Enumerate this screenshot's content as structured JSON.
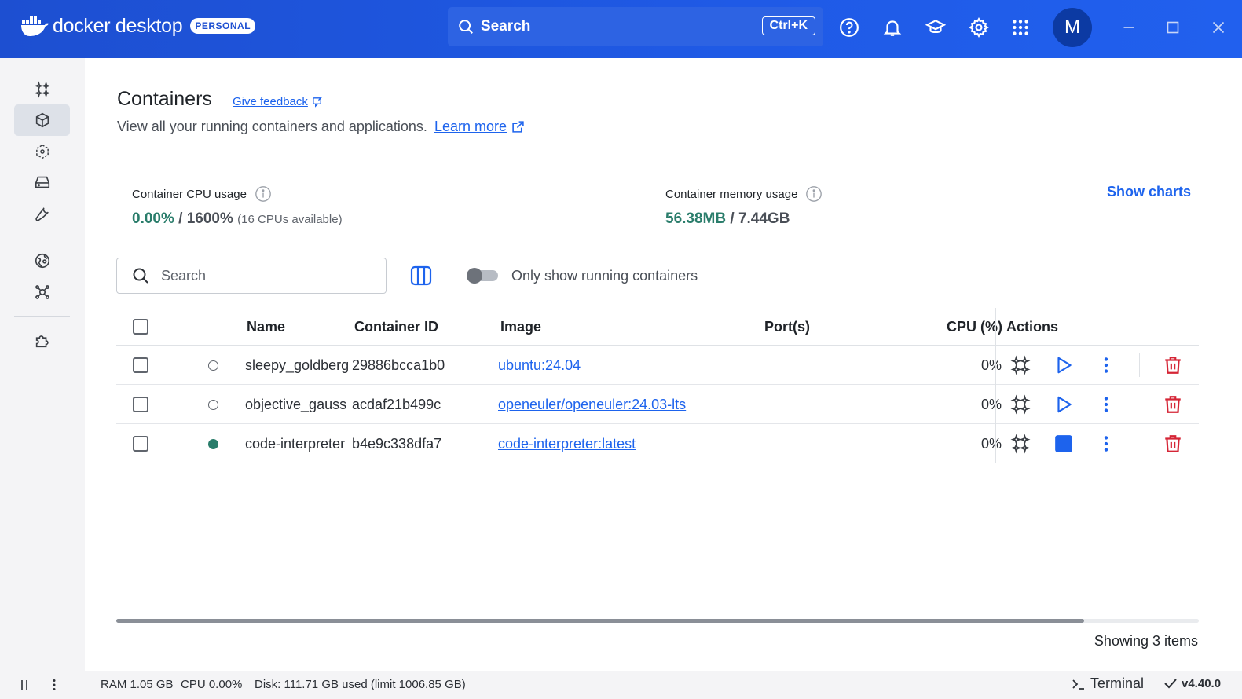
{
  "app": {
    "brand": "docker desktop",
    "plan_badge": "PERSONAL",
    "search_label": "Search",
    "search_shortcut": "Ctrl+K",
    "user_initial": "M",
    "accent": "#1d63ed"
  },
  "sidebar": {
    "items": [
      {
        "icon": "ai-sparkle-icon",
        "active": false
      },
      {
        "icon": "containers-icon",
        "active": true
      },
      {
        "icon": "images-icon",
        "active": false
      },
      {
        "icon": "volumes-icon",
        "active": false
      },
      {
        "icon": "builds-icon",
        "active": false
      },
      {
        "icon": "docker-hub-icon",
        "active": false
      },
      {
        "icon": "scout-icon",
        "active": false
      },
      {
        "icon": "extensions-icon",
        "active": false
      }
    ]
  },
  "page": {
    "title": "Containers",
    "feedback_link": "Give feedback",
    "subtitle": "View all your running containers and applications.",
    "learn_more": "Learn more"
  },
  "stats": {
    "cpu_label": "Container CPU usage",
    "cpu_used": "0.00%",
    "cpu_sep": "/",
    "cpu_total": "1600%",
    "cpu_extra": "(16 CPUs available)",
    "mem_label": "Container memory usage",
    "mem_used": "56.38MB",
    "mem_sep": "/",
    "mem_total": "7.44GB",
    "show_charts": "Show charts"
  },
  "filter": {
    "search_placeholder": "Search",
    "toggle_label": "Only show running containers",
    "toggle_on": false
  },
  "table": {
    "headers": {
      "name": "Name",
      "container_id": "Container ID",
      "image": "Image",
      "ports": "Port(s)",
      "cpu": "CPU (%)",
      "actions": "Actions"
    },
    "rows": [
      {
        "name": "sleepy_goldberg",
        "container_id": "29886bcca1b0",
        "image": "ubuntu:24.04",
        "ports": "",
        "cpu": "0%",
        "status": "stopped"
      },
      {
        "name": "objective_gauss",
        "container_id": "acdaf21b499c",
        "image": "openeuler/openeuler:24.03-lts",
        "ports": "",
        "cpu": "0%",
        "status": "stopped"
      },
      {
        "name": "code-interpreter",
        "container_id": "b4e9c338dfa7",
        "image": "code-interpreter:latest",
        "ports": "",
        "cpu": "0%",
        "status": "running"
      }
    ],
    "showing": "Showing 3 items",
    "scroll_fraction": 0.894
  },
  "footer": {
    "ram": "RAM 1.05 GB",
    "cpu": "CPU 0.00%",
    "disk": "Disk: 111.71 GB used (limit 1006.85 GB)",
    "terminal": "Terminal",
    "version": "v4.40.0"
  }
}
